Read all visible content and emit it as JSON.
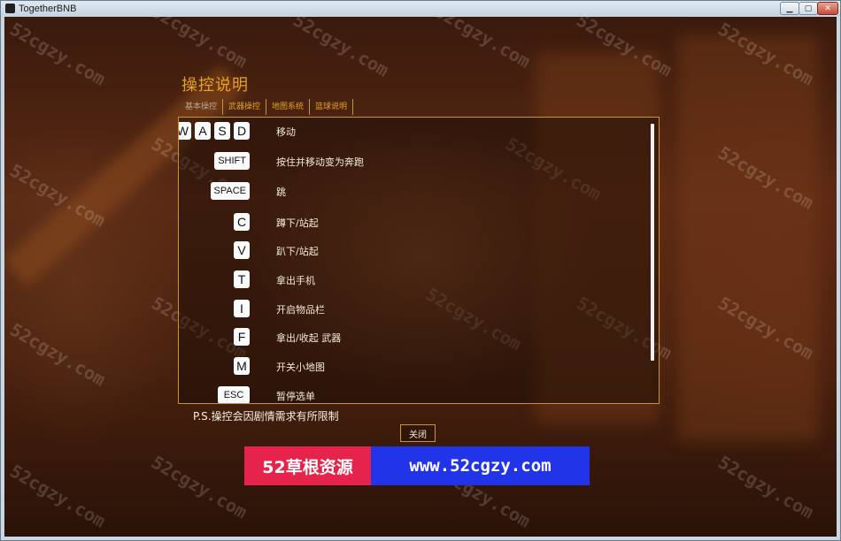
{
  "window": {
    "title": "TogetherBNB",
    "buttons": {
      "minimize": "▁",
      "maximize": "▢",
      "close": "✕"
    }
  },
  "panel": {
    "title": "操控说明",
    "tabs": [
      {
        "label": "基本操控",
        "active": false
      },
      {
        "label": "武器操控",
        "active": true
      },
      {
        "label": "地图系统",
        "active": true
      },
      {
        "label": "篮球说明",
        "active": true
      }
    ],
    "controls": [
      {
        "keys": [
          "W",
          "A",
          "S",
          "D"
        ],
        "action": "移动"
      },
      {
        "keys": [
          "SHIFT"
        ],
        "action": "按住并移动变为奔跑"
      },
      {
        "keys": [
          "SPACE"
        ],
        "action": "跳"
      },
      {
        "keys": [
          "C"
        ],
        "action": "蹲下/站起"
      },
      {
        "keys": [
          "V"
        ],
        "action": "趴下/站起"
      },
      {
        "keys": [
          "T"
        ],
        "action": "拿出手机"
      },
      {
        "keys": [
          "I"
        ],
        "action": "开启物品栏"
      },
      {
        "keys": [
          "F"
        ],
        "action": "拿出/收起 武器"
      },
      {
        "keys": [
          "M"
        ],
        "action": "开关小地图"
      },
      {
        "keys": [
          "ESC"
        ],
        "action": "暂停选单"
      }
    ],
    "note": "P.S.操控会因剧情需求有所限制",
    "close_label": "关闭"
  },
  "banner": {
    "left_text": "52草根资源",
    "right_text": "www.52cgzy.com",
    "left_color": "#e6234a",
    "right_color": "#2134e8"
  },
  "watermark": {
    "text": "52cgzy.com"
  },
  "colors": {
    "accent": "#e6a21d",
    "border": "#c89628"
  }
}
